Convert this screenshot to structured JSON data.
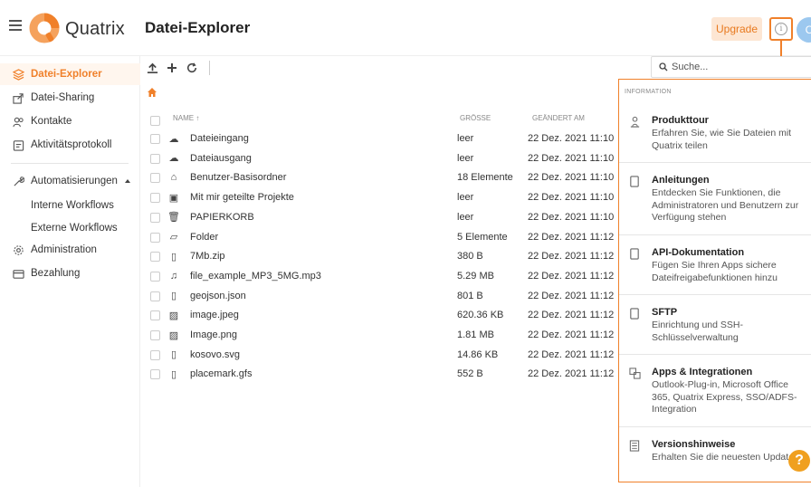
{
  "header": {
    "brand": "Quatrix",
    "title": "Datei-Explorer",
    "upgrade_label": "Upgrade",
    "info_glyph": "i",
    "avatar_initial": "C",
    "accent": "#f0802a"
  },
  "sidebar": {
    "items": [
      {
        "label": "Datei-Explorer",
        "icon": "stack-icon"
      },
      {
        "label": "Datei-Sharing",
        "icon": "share-icon"
      },
      {
        "label": "Kontakte",
        "icon": "contacts-icon"
      },
      {
        "label": "Aktivitätsprotokoll",
        "icon": "log-icon"
      },
      {
        "label": "Automatisierungen",
        "icon": "wrench-icon"
      },
      {
        "label": "Interne Workflows"
      },
      {
        "label": "Externe Workflows"
      },
      {
        "label": "Administration",
        "icon": "admin-gear-icon"
      },
      {
        "label": "Bezahlung",
        "icon": "card-icon"
      }
    ]
  },
  "search": {
    "placeholder": "Suche..."
  },
  "table": {
    "headers": {
      "name": "NAME ↑",
      "size": "GRÖSSE",
      "changed": "GEÄNDERT AM"
    },
    "rows": [
      {
        "name": "Dateieingang",
        "size": "leer",
        "date": "22 Dez. 2021 11:10",
        "icon": "cloud-upload-icon"
      },
      {
        "name": "Dateiausgang",
        "size": "leer",
        "date": "22 Dez. 2021 11:10",
        "icon": "cloud-download-icon"
      },
      {
        "name": "Benutzer-Basisordner",
        "size": "18 Elemente",
        "date": "22 Dez. 2021 11:10",
        "icon": "home-folder-icon"
      },
      {
        "name": "Mit mir geteilte Projekte",
        "size": "leer",
        "date": "22 Dez. 2021 11:10",
        "icon": "shared-folder-icon"
      },
      {
        "name": "PAPIERKORB",
        "size": "leer",
        "date": "22 Dez. 2021 11:10",
        "icon": "trash-icon"
      },
      {
        "name": "Folder",
        "size": "5 Elemente",
        "date": "22 Dez. 2021 11:12",
        "icon": "folder-icon"
      },
      {
        "name": "7Mb.zip",
        "size": "380 B",
        "date": "22 Dez. 2021 11:12",
        "icon": "zip-file-icon"
      },
      {
        "name": "file_example_MP3_5MG.mp3",
        "size": "5.29 MB",
        "date": "22 Dez. 2021 11:12",
        "icon": "audio-file-icon"
      },
      {
        "name": "geojson.json",
        "size": "801 B",
        "date": "22 Dez. 2021 11:12",
        "icon": "file-icon"
      },
      {
        "name": "image.jpeg",
        "size": "620.36 KB",
        "date": "22 Dez. 2021 11:12",
        "icon": "image-file-icon"
      },
      {
        "name": "Image.png",
        "size": "1.81 MB",
        "date": "22 Dez. 2021 11:12",
        "icon": "image-file-icon"
      },
      {
        "name": "kosovo.svg",
        "size": "14.86 KB",
        "date": "22 Dez. 2021 11:12",
        "icon": "file-icon"
      },
      {
        "name": "placemark.gfs",
        "size": "552 B",
        "date": "22 Dez. 2021 11:12",
        "icon": "file-icon"
      }
    ]
  },
  "info_panel": {
    "heading": "INFORMATION",
    "items": [
      {
        "title": "Produkttour",
        "desc": "Erfahren Sie, wie Sie Dateien mit Quatrix teilen",
        "icon": "tour-icon"
      },
      {
        "title": "Anleitungen",
        "desc": "Entdecken Sie Funktionen, die Administratoren und Benutzern zur Verfügung stehen",
        "icon": "book-icon"
      },
      {
        "title": "API-Dokumentation",
        "desc": "Fügen Sie Ihren Apps sichere Dateifreigabefunktionen hinzu",
        "icon": "api-book-icon"
      },
      {
        "title": "SFTP",
        "desc": "Einrichtung und SSH-Schlüsselverwaltung",
        "icon": "sftp-book-icon"
      },
      {
        "title": "Apps & Integrationen",
        "desc": "Outlook-Plug-in, Microsoft Office 365, Quatrix Express, SSO/ADFS-Integration",
        "icon": "apps-icon"
      },
      {
        "title": "Versionshinweise",
        "desc": "Erhalten Sie die neuesten Updates",
        "icon": "notes-icon"
      }
    ]
  },
  "help_label": "?"
}
